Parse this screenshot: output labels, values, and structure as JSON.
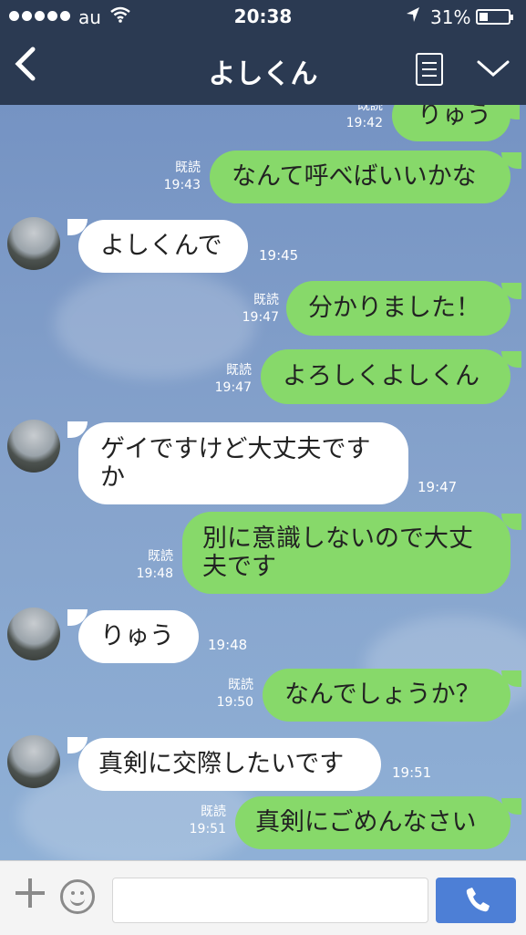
{
  "status": {
    "carrier": "au",
    "time": "20:38",
    "battery": "31%",
    "battery_level": 0.31
  },
  "header": {
    "title": "よしくん",
    "back_icon": "chevron-left-icon",
    "notes_icon": "notes-icon",
    "menu_icon": "chevron-down-icon"
  },
  "messages": [
    {
      "dir": "out",
      "text": "りゅう",
      "read": "既読",
      "time": "19:42"
    },
    {
      "dir": "out",
      "text": "なんて呼べばいいかな",
      "read": "既読",
      "time": "19:43"
    },
    {
      "dir": "in",
      "text": "よしくんで",
      "time": "19:45"
    },
    {
      "dir": "out",
      "text": "分かりました！",
      "read": "既読",
      "time": "19:47"
    },
    {
      "dir": "out",
      "text": "よろしくよしくん",
      "read": "既読",
      "time": "19:47"
    },
    {
      "dir": "in",
      "text": "ゲイですけど大丈夫です\nか",
      "time": "19:47"
    },
    {
      "dir": "out",
      "text": "別に意識しないので大丈\n夫です",
      "read": "既読",
      "time": "19:48"
    },
    {
      "dir": "in",
      "text": "りゅう",
      "time": "19:48"
    },
    {
      "dir": "out",
      "text": "なんでしょうか？",
      "read": "既読",
      "time": "19:50"
    },
    {
      "dir": "in",
      "text": "真剣に交際したいです",
      "time": "19:51"
    },
    {
      "dir": "out",
      "text": "真剣にごめんなさい",
      "read": "既読",
      "time": "19:51"
    }
  ],
  "input": {
    "placeholder": "",
    "plus_icon": "plus-icon",
    "sticker_icon": "smiley-icon",
    "call_icon": "phone-icon"
  },
  "colors": {
    "header_bg": "#2b3a52",
    "bubble_out": "#87d96a",
    "bubble_in": "#ffffff",
    "chat_bg": "#7d9ac6",
    "call_button": "#4d7fd6"
  }
}
